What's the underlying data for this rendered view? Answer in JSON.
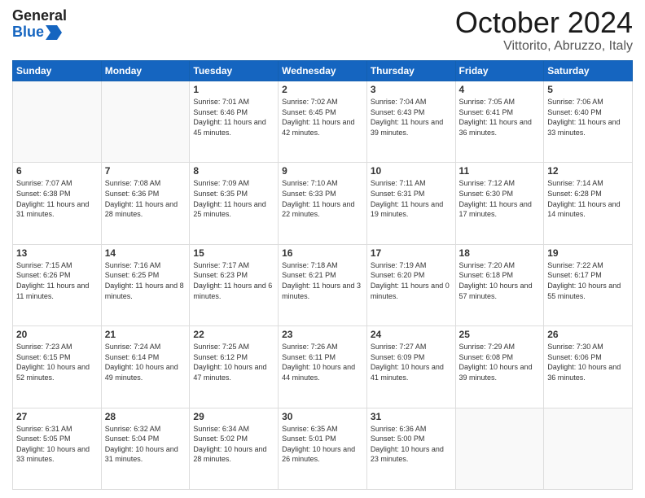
{
  "header": {
    "logo_general": "General",
    "logo_blue": "Blue",
    "month": "October 2024",
    "location": "Vittorito, Abruzzo, Italy"
  },
  "weekdays": [
    "Sunday",
    "Monday",
    "Tuesday",
    "Wednesday",
    "Thursday",
    "Friday",
    "Saturday"
  ],
  "weeks": [
    [
      {
        "day": "",
        "info": ""
      },
      {
        "day": "",
        "info": ""
      },
      {
        "day": "1",
        "info": "Sunrise: 7:01 AM\nSunset: 6:46 PM\nDaylight: 11 hours and 45 minutes."
      },
      {
        "day": "2",
        "info": "Sunrise: 7:02 AM\nSunset: 6:45 PM\nDaylight: 11 hours and 42 minutes."
      },
      {
        "day": "3",
        "info": "Sunrise: 7:04 AM\nSunset: 6:43 PM\nDaylight: 11 hours and 39 minutes."
      },
      {
        "day": "4",
        "info": "Sunrise: 7:05 AM\nSunset: 6:41 PM\nDaylight: 11 hours and 36 minutes."
      },
      {
        "day": "5",
        "info": "Sunrise: 7:06 AM\nSunset: 6:40 PM\nDaylight: 11 hours and 33 minutes."
      }
    ],
    [
      {
        "day": "6",
        "info": "Sunrise: 7:07 AM\nSunset: 6:38 PM\nDaylight: 11 hours and 31 minutes."
      },
      {
        "day": "7",
        "info": "Sunrise: 7:08 AM\nSunset: 6:36 PM\nDaylight: 11 hours and 28 minutes."
      },
      {
        "day": "8",
        "info": "Sunrise: 7:09 AM\nSunset: 6:35 PM\nDaylight: 11 hours and 25 minutes."
      },
      {
        "day": "9",
        "info": "Sunrise: 7:10 AM\nSunset: 6:33 PM\nDaylight: 11 hours and 22 minutes."
      },
      {
        "day": "10",
        "info": "Sunrise: 7:11 AM\nSunset: 6:31 PM\nDaylight: 11 hours and 19 minutes."
      },
      {
        "day": "11",
        "info": "Sunrise: 7:12 AM\nSunset: 6:30 PM\nDaylight: 11 hours and 17 minutes."
      },
      {
        "day": "12",
        "info": "Sunrise: 7:14 AM\nSunset: 6:28 PM\nDaylight: 11 hours and 14 minutes."
      }
    ],
    [
      {
        "day": "13",
        "info": "Sunrise: 7:15 AM\nSunset: 6:26 PM\nDaylight: 11 hours and 11 minutes."
      },
      {
        "day": "14",
        "info": "Sunrise: 7:16 AM\nSunset: 6:25 PM\nDaylight: 11 hours and 8 minutes."
      },
      {
        "day": "15",
        "info": "Sunrise: 7:17 AM\nSunset: 6:23 PM\nDaylight: 11 hours and 6 minutes."
      },
      {
        "day": "16",
        "info": "Sunrise: 7:18 AM\nSunset: 6:21 PM\nDaylight: 11 hours and 3 minutes."
      },
      {
        "day": "17",
        "info": "Sunrise: 7:19 AM\nSunset: 6:20 PM\nDaylight: 11 hours and 0 minutes."
      },
      {
        "day": "18",
        "info": "Sunrise: 7:20 AM\nSunset: 6:18 PM\nDaylight: 10 hours and 57 minutes."
      },
      {
        "day": "19",
        "info": "Sunrise: 7:22 AM\nSunset: 6:17 PM\nDaylight: 10 hours and 55 minutes."
      }
    ],
    [
      {
        "day": "20",
        "info": "Sunrise: 7:23 AM\nSunset: 6:15 PM\nDaylight: 10 hours and 52 minutes."
      },
      {
        "day": "21",
        "info": "Sunrise: 7:24 AM\nSunset: 6:14 PM\nDaylight: 10 hours and 49 minutes."
      },
      {
        "day": "22",
        "info": "Sunrise: 7:25 AM\nSunset: 6:12 PM\nDaylight: 10 hours and 47 minutes."
      },
      {
        "day": "23",
        "info": "Sunrise: 7:26 AM\nSunset: 6:11 PM\nDaylight: 10 hours and 44 minutes."
      },
      {
        "day": "24",
        "info": "Sunrise: 7:27 AM\nSunset: 6:09 PM\nDaylight: 10 hours and 41 minutes."
      },
      {
        "day": "25",
        "info": "Sunrise: 7:29 AM\nSunset: 6:08 PM\nDaylight: 10 hours and 39 minutes."
      },
      {
        "day": "26",
        "info": "Sunrise: 7:30 AM\nSunset: 6:06 PM\nDaylight: 10 hours and 36 minutes."
      }
    ],
    [
      {
        "day": "27",
        "info": "Sunrise: 6:31 AM\nSunset: 5:05 PM\nDaylight: 10 hours and 33 minutes."
      },
      {
        "day": "28",
        "info": "Sunrise: 6:32 AM\nSunset: 5:04 PM\nDaylight: 10 hours and 31 minutes."
      },
      {
        "day": "29",
        "info": "Sunrise: 6:34 AM\nSunset: 5:02 PM\nDaylight: 10 hours and 28 minutes."
      },
      {
        "day": "30",
        "info": "Sunrise: 6:35 AM\nSunset: 5:01 PM\nDaylight: 10 hours and 26 minutes."
      },
      {
        "day": "31",
        "info": "Sunrise: 6:36 AM\nSunset: 5:00 PM\nDaylight: 10 hours and 23 minutes."
      },
      {
        "day": "",
        "info": ""
      },
      {
        "day": "",
        "info": ""
      }
    ]
  ]
}
